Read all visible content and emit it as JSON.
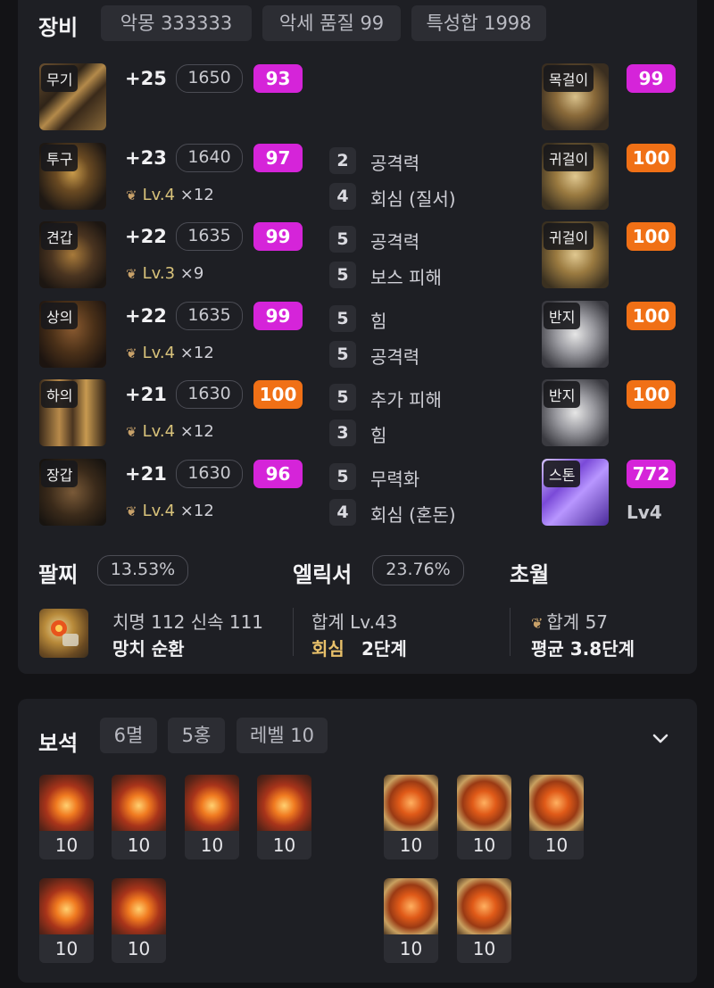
{
  "equipment": {
    "title": "장비",
    "chips": [
      "악몽 333333",
      "악세 품질 99",
      "특성합 1998"
    ],
    "armor": [
      {
        "slot": "무기",
        "plus": "+25",
        "level": "1650",
        "quality": "93",
        "quality_color": "#d524d9",
        "glove_lv": "",
        "glove_count": "",
        "engravings": []
      },
      {
        "slot": "투구",
        "plus": "+23",
        "level": "1640",
        "quality": "97",
        "quality_color": "#d524d9",
        "glove_lv": "Lv.4",
        "glove_count": "×12",
        "engravings": [
          {
            "n": "2",
            "label": "공격력"
          },
          {
            "n": "4",
            "label": "회심 (질서)"
          }
        ]
      },
      {
        "slot": "견갑",
        "plus": "+22",
        "level": "1635",
        "quality": "99",
        "quality_color": "#d524d9",
        "glove_lv": "Lv.3",
        "glove_count": "×9",
        "engravings": [
          {
            "n": "5",
            "label": "공격력"
          },
          {
            "n": "5",
            "label": "보스 피해"
          }
        ]
      },
      {
        "slot": "상의",
        "plus": "+22",
        "level": "1635",
        "quality": "99",
        "quality_color": "#d524d9",
        "glove_lv": "Lv.4",
        "glove_count": "×12",
        "engravings": [
          {
            "n": "5",
            "label": "힘"
          },
          {
            "n": "5",
            "label": "공격력"
          }
        ]
      },
      {
        "slot": "하의",
        "plus": "+21",
        "level": "1630",
        "quality": "100",
        "quality_color": "#f07016",
        "glove_lv": "Lv.4",
        "glove_count": "×12",
        "engravings": [
          {
            "n": "5",
            "label": "추가 피해"
          },
          {
            "n": "3",
            "label": "힘"
          }
        ]
      },
      {
        "slot": "장갑",
        "plus": "+21",
        "level": "1630",
        "quality": "96",
        "quality_color": "#d524d9",
        "glove_lv": "Lv.4",
        "glove_count": "×12",
        "engravings": [
          {
            "n": "5",
            "label": "무력화"
          },
          {
            "n": "4",
            "label": "회심 (혼돈)"
          }
        ]
      }
    ],
    "accessories": [
      {
        "slot": "목걸이",
        "quality": "99",
        "quality_color": "#d524d9"
      },
      {
        "slot": "귀걸이",
        "quality": "100",
        "quality_color": "#f07016"
      },
      {
        "slot": "귀걸이",
        "quality": "100",
        "quality_color": "#f07016"
      },
      {
        "slot": "반지",
        "quality": "100",
        "quality_color": "#f07016"
      },
      {
        "slot": "반지",
        "quality": "100",
        "quality_color": "#f07016"
      },
      {
        "slot": "스톤",
        "quality": "772",
        "quality_color": "#d524d9",
        "extra": "Lv4"
      }
    ]
  },
  "bracelet": {
    "title": "팔찌",
    "percent": "13.53%",
    "stats": "치명 112  신속 111",
    "effects": "망치  순환"
  },
  "elixir": {
    "title": "엘릭서",
    "percent": "23.76%",
    "total": "합계 Lv.43",
    "effect_name": "회심",
    "effect_stage": "2단계"
  },
  "transcend": {
    "title": "초월",
    "total": "합계 57",
    "average": "평균 3.8단계"
  },
  "gems": {
    "title": "보석",
    "chips": [
      "6멸",
      "5홍",
      "레벨 10"
    ],
    "left": [
      "10",
      "10",
      "10",
      "10",
      "10",
      "10"
    ],
    "right": [
      "10",
      "10",
      "10",
      "10",
      "10"
    ]
  },
  "colors": {
    "accent_purple": "#d524d9",
    "accent_orange": "#f07016",
    "elixir_gold": "#e8c06a"
  },
  "icons": [
    "chevron-down-icon",
    "transcend-flower-icon"
  ]
}
